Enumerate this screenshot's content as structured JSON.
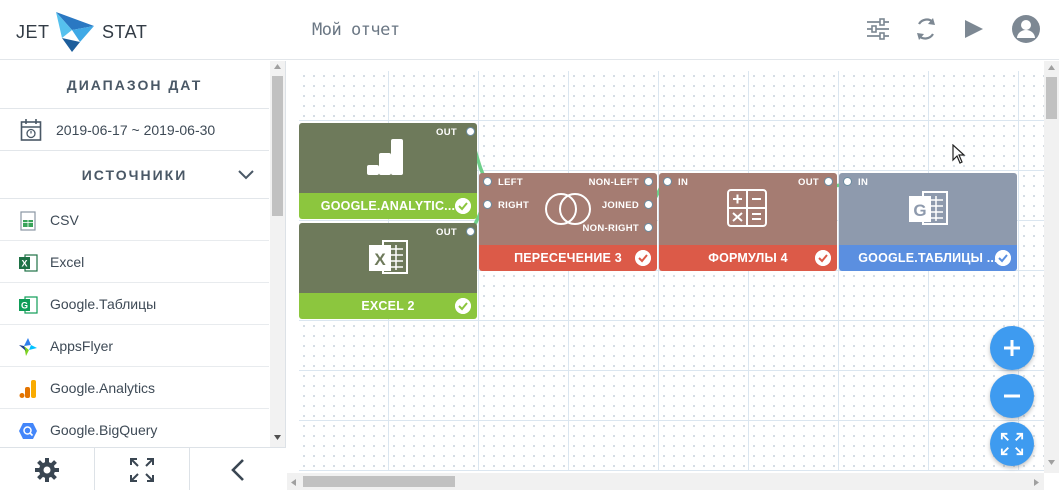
{
  "header": {
    "logo_left": "JET",
    "logo_right": "STAT",
    "report_title": "Мой отчет"
  },
  "sidebar": {
    "date_section_title": "ДИАПАЗОН ДАТ",
    "date_range": "2019-06-17 ~ 2019-06-30",
    "sources_section_title": "ИСТОЧНИКИ",
    "sources": [
      {
        "label": "CSV",
        "icon": "csv-file-icon"
      },
      {
        "label": "Excel",
        "icon": "excel-icon"
      },
      {
        "label": "Google.Таблицы",
        "icon": "google-sheets-icon"
      },
      {
        "label": "AppsFlyer",
        "icon": "appsflyer-icon"
      },
      {
        "label": "Google.Analytics",
        "icon": "google-analytics-icon"
      },
      {
        "label": "Google.BigQuery",
        "icon": "google-bigquery-icon"
      }
    ]
  },
  "nodes": {
    "ga": {
      "title": "GOOGLE.ANALYTIC...",
      "out": "OUT"
    },
    "excel": {
      "title": "EXCEL 2",
      "out": "OUT"
    },
    "intersect": {
      "title": "ПЕРЕСЕЧЕНИЕ 3",
      "left": "LEFT",
      "right": "RIGHT",
      "non_left": "NON-LEFT",
      "joined": "JOINED",
      "non_right": "NON-RIGHT"
    },
    "formulas": {
      "title": "ФОРМУЛЫ 4",
      "in": "IN",
      "out": "OUT"
    },
    "gsheets": {
      "title": "GOOGLE.ТАБЛИЦЫ ...",
      "in": "IN",
      "sheet_letter": "G"
    }
  },
  "colors": {
    "source_node_body": "#6e7a5b",
    "source_node_footer": "#8cc63e",
    "transform_node_body": "#a57c72",
    "transform_node_footer": "#dc5a48",
    "output_node_body": "#8e9aad",
    "output_node_footer": "#5b8fe0",
    "connector": "#6fcf8a",
    "zoom_button": "#3e9bf0"
  }
}
